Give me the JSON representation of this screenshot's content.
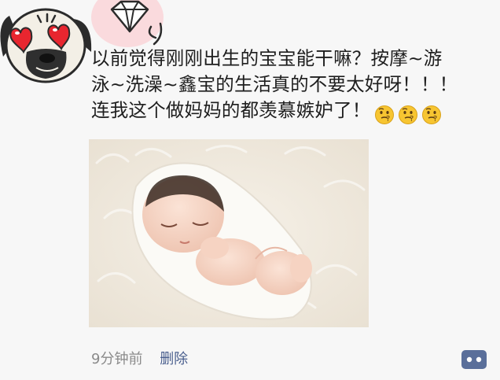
{
  "post": {
    "text_lines": [
      "以前觉得刚刚出生的宝宝能干嘛？按摩~游",
      "泳~洗澡~鑫宝的生活真的不要太好呀！！！",
      "连我这个做妈妈的都羡慕嫉妒了！"
    ],
    "emoji": [
      "thinking-face-icon",
      "thinking-face-icon",
      "thinking-face-icon"
    ],
    "image": "sleeping-newborn-photo",
    "time": "9分钟前",
    "delete_label": "删除"
  },
  "avatar": {
    "icon": "pug-heart-eyes-avatar"
  },
  "sticker": {
    "icon": "diamond-sticker"
  },
  "colors": {
    "background": "#f7f7f7",
    "text": "#1e1e1e",
    "link": "#4a5f8e",
    "muted": "#8a8a8a",
    "comment_button": "#5a6f9a"
  }
}
